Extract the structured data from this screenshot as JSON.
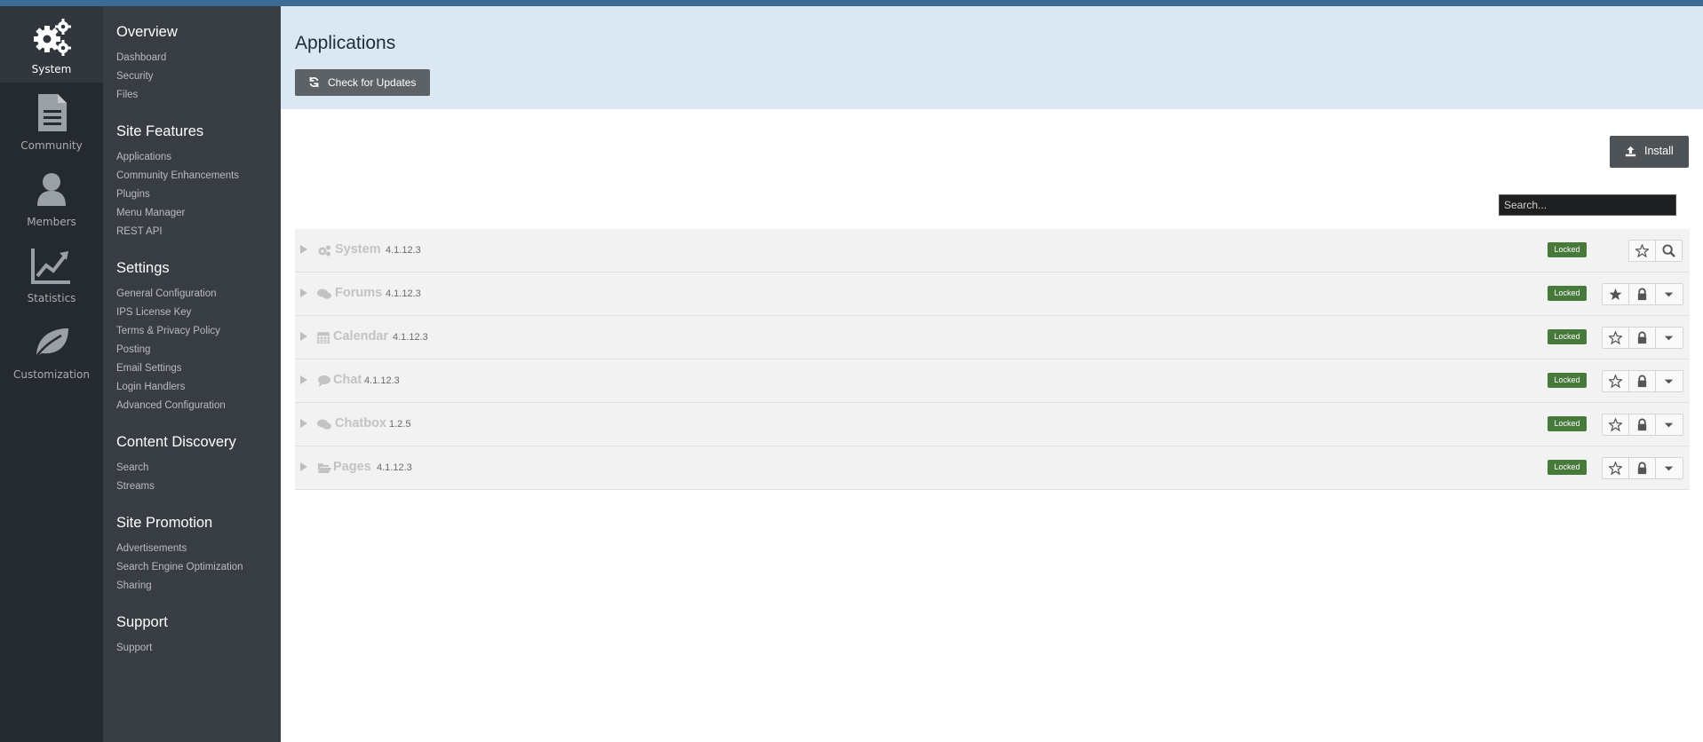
{
  "rail": [
    {
      "label": "System",
      "icon": "cogs-icon",
      "active": true
    },
    {
      "label": "Community",
      "icon": "document-icon"
    },
    {
      "label": "Members",
      "icon": "user-icon"
    },
    {
      "label": "Statistics",
      "icon": "line-chart-icon"
    },
    {
      "label": "Customization",
      "icon": "leaf-icon"
    }
  ],
  "menu": {
    "sections": [
      {
        "title": "Overview",
        "items": [
          "Dashboard",
          "Security",
          "Files"
        ]
      },
      {
        "title": "Site Features",
        "items": [
          "Applications",
          "Community Enhancements",
          "Plugins",
          "Menu Manager",
          "REST API"
        ]
      },
      {
        "title": "Settings",
        "items": [
          "General Configuration",
          "IPS License Key",
          "Terms & Privacy Policy",
          "Posting",
          "Email Settings",
          "Login Handlers",
          "Advanced Configuration"
        ]
      },
      {
        "title": "Content Discovery",
        "items": [
          "Search",
          "Streams"
        ]
      },
      {
        "title": "Site Promotion",
        "items": [
          "Advertisements",
          "Search Engine Optimization",
          "Sharing"
        ]
      },
      {
        "title": "Support",
        "items": [
          "Support"
        ]
      }
    ]
  },
  "header": {
    "title": "Applications",
    "check_updates_label": "Check for Updates"
  },
  "toolbar": {
    "install_label": "Install",
    "search_placeholder": "Search..."
  },
  "colors": {
    "accent": "#3e6b94",
    "rail_bg": "#252a2f",
    "menu_bg": "#373d43",
    "header_bg": "#dbe7f2",
    "locked_badge": "#47793a"
  },
  "apps": [
    {
      "name": "System",
      "version": "4.1.12.3",
      "status": "Locked",
      "icon": "cogs-icon",
      "default": false,
      "actions": [
        "star",
        "search"
      ]
    },
    {
      "name": "Forums",
      "version": "4.1.12.3",
      "status": "Locked",
      "icon": "comments-icon",
      "default": true,
      "actions": [
        "star",
        "lock",
        "dropdown"
      ]
    },
    {
      "name": "Calendar",
      "version": "4.1.12.3",
      "status": "Locked",
      "icon": "calendar-icon",
      "default": false,
      "actions": [
        "star",
        "lock",
        "dropdown"
      ]
    },
    {
      "name": "Chat",
      "version": "4.1.12.3",
      "status": "Locked",
      "icon": "comment-icon",
      "default": false,
      "actions": [
        "star",
        "lock",
        "dropdown"
      ]
    },
    {
      "name": "Chatbox",
      "version": "1.2.5",
      "status": "Locked",
      "icon": "comments-icon",
      "default": false,
      "actions": [
        "star",
        "lock",
        "dropdown"
      ]
    },
    {
      "name": "Pages",
      "version": "4.1.12.3",
      "status": "Locked",
      "icon": "folder-open-icon",
      "default": false,
      "actions": [
        "star",
        "lock",
        "dropdown"
      ]
    }
  ]
}
